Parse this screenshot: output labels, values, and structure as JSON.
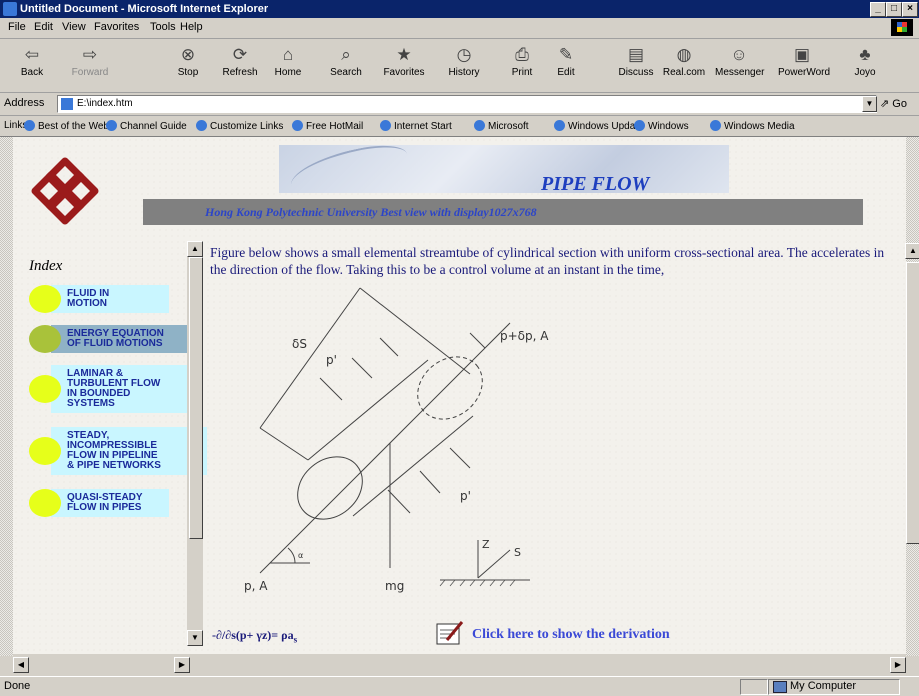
{
  "window": {
    "title": "Untitled Document - Microsoft Internet Explorer"
  },
  "menu": [
    "File",
    "Edit",
    "View",
    "Favorites",
    "Tools",
    "Help"
  ],
  "toolbar": [
    {
      "label": "Back",
      "icon": "back-arrow-icon",
      "glyph": "⇦"
    },
    {
      "label": "Forward",
      "icon": "forward-arrow-icon",
      "glyph": "⇨"
    },
    {
      "label": "Stop",
      "icon": "stop-icon",
      "glyph": "⊗"
    },
    {
      "label": "Refresh",
      "icon": "refresh-icon",
      "glyph": "⟳"
    },
    {
      "label": "Home",
      "icon": "home-icon",
      "glyph": "⌂"
    },
    {
      "label": "Search",
      "icon": "search-icon",
      "glyph": "⌕"
    },
    {
      "label": "Favorites",
      "icon": "favorites-icon",
      "glyph": "★"
    },
    {
      "label": "History",
      "icon": "history-icon",
      "glyph": "◷"
    },
    {
      "label": "Print",
      "icon": "print-icon",
      "glyph": "⎙"
    },
    {
      "label": "Edit",
      "icon": "edit-icon",
      "glyph": "✎"
    },
    {
      "label": "Discuss",
      "icon": "discuss-icon",
      "glyph": "▤"
    },
    {
      "label": "Real.com",
      "icon": "real-icon",
      "glyph": "◍"
    },
    {
      "label": "Messenger",
      "icon": "messenger-icon",
      "glyph": "☺"
    },
    {
      "label": "PowerWord",
      "icon": "powerword-icon",
      "glyph": "▣"
    },
    {
      "label": "Joyo",
      "icon": "joyo-icon",
      "glyph": "♣"
    }
  ],
  "address": {
    "label": "Address",
    "value": "E:\\index.htm",
    "go": "Go"
  },
  "links": {
    "label": "Links",
    "items": [
      "Best of the Web",
      "Channel Guide",
      "Customize Links",
      "Free HotMail",
      "Internet Start",
      "Microsoft",
      "Windows Update",
      "Windows",
      "Windows Media"
    ]
  },
  "page": {
    "banner_title": "PIPE FLOW",
    "subtitle": "Hong Kong Polytechnic University  Best view with display1027x768",
    "index_title": "Index",
    "nav": [
      {
        "label": "FLUID IN MOTION",
        "lines": [
          "FLUID IN",
          "MOTION"
        ]
      },
      {
        "label": "ENERGY EQUATION OF FLUID MOTIONS",
        "lines": [
          "ENERGY EQUATION",
          "OF FLUID MOTIONS"
        ]
      },
      {
        "label": "LAMINAR & TURBULENT FLOW IN BOUNDED SYSTEMS",
        "lines": [
          "LAMINAR &",
          "TURBULENT FLOW",
          "IN BOUNDED",
          "SYSTEMS"
        ]
      },
      {
        "label": "STEADY, INCOMPRESSIBLE FLOW IN PIPELINE & PIPE NETWORKS",
        "lines": [
          "STEADY,",
          "INCOMPRESSIBLE",
          "FLOW IN PIPELINE",
          "& PIPE  NETWORKS"
        ]
      },
      {
        "label": "QUASI-STEADY FLOW IN PIPES",
        "lines": [
          "QUASI-STEADY",
          "FLOW IN PIPES"
        ]
      }
    ],
    "paragraph": "Figure below shows a small elemental streamtube of cylindrical section with uniform cross-sectional area. The accelerates in the direction of the flow.  Taking this to be a control volume at an instant in the time,",
    "diagram_labels": {
      "ds": "δS",
      "p_prime_top": "p'",
      "p_plus": "p+δp, A",
      "p_prime_bottom": "p'",
      "alpha": "α",
      "pa": "p, A",
      "mg": "mg",
      "z": "Z",
      "s": "S"
    },
    "formula_main": "-∂/∂s(p+ γz)= ρa",
    "formula_sub": "s",
    "derivation_link": "Click here to show the derivation"
  },
  "status": {
    "text": "Done",
    "zone": "My Computer"
  },
  "colors": {
    "titlebar": "#0a246a",
    "link": "#3b49d6",
    "body_text": "#1a1a7a",
    "nav_dot": "#e6ff1a",
    "nav_bg": "#c9f6ff"
  }
}
